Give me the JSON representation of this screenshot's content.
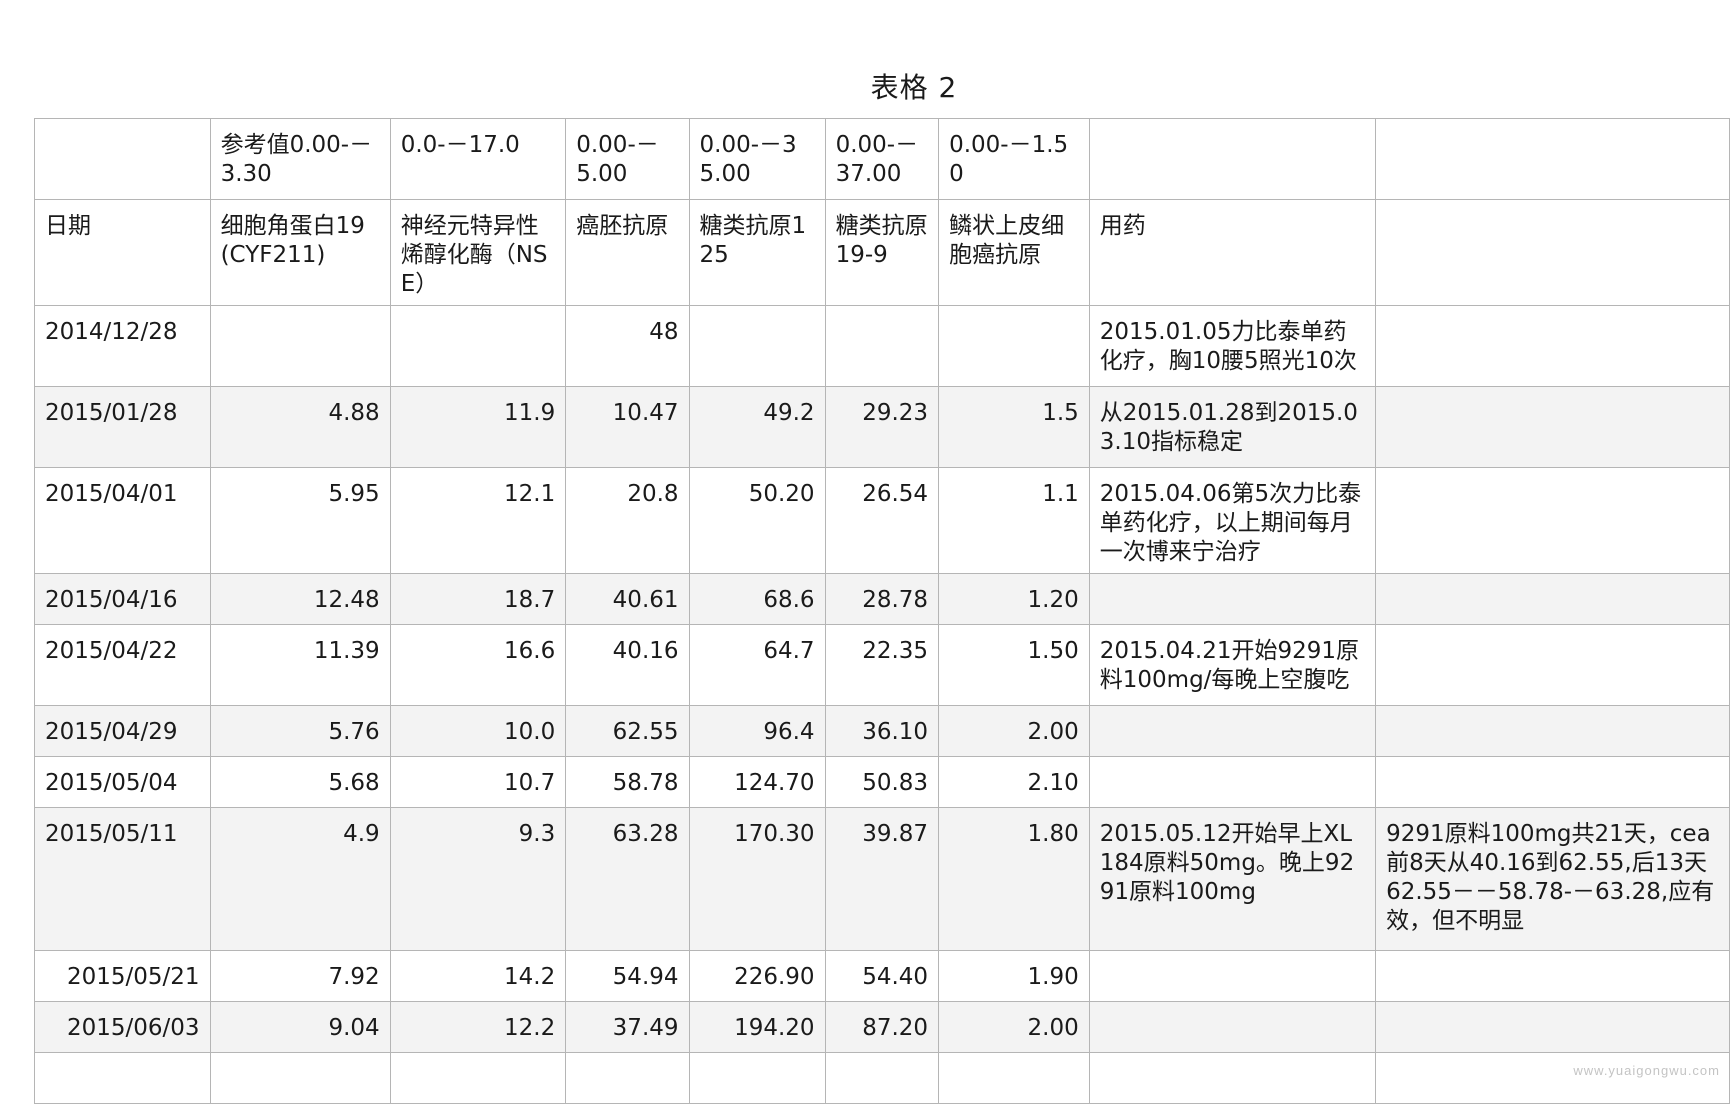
{
  "title": "表格 2",
  "reference_row": [
    "",
    "参考值0.00-－3.30",
    "0.0-－17.0",
    "0.00-－5.00",
    "0.00-－35.00",
    "0.00-－37.00",
    "0.00-－1.50",
    "",
    ""
  ],
  "header_row": [
    "日期",
    "细胞角蛋白19(CYF211)",
    "神经元特异性烯醇化酶（NSE）",
    "癌胚抗原",
    "糖类抗原125",
    "糖类抗原19-9",
    "鳞状上皮细胞癌抗原",
    "用药",
    ""
  ],
  "rows": [
    [
      "2014/12/28",
      "",
      "",
      "48",
      "",
      "",
      "",
      "2015.01.05力比泰单药化疗，胸10腰5照光10次",
      ""
    ],
    [
      "2015/01/28",
      "4.88",
      "11.9",
      "10.47",
      "49.2",
      "29.23",
      "1.5",
      "从2015.01.28到2015.03.10指标稳定",
      ""
    ],
    [
      "2015/04/01",
      "5.95",
      "12.1",
      "20.8",
      "50.20",
      "26.54",
      "1.1",
      "2015.04.06第5次力比泰单药化疗，以上期间每月一次博来宁治疗",
      ""
    ],
    [
      "2015/04/16",
      "12.48",
      "18.7",
      "40.61",
      "68.6",
      "28.78",
      "1.20",
      "",
      ""
    ],
    [
      "2015/04/22",
      "11.39",
      "16.6",
      "40.16",
      "64.7",
      "22.35",
      "1.50",
      "2015.04.21开始9291原料100mg/每晚上空腹吃",
      ""
    ],
    [
      "2015/04/29",
      "5.76",
      "10.0",
      "62.55",
      "96.4",
      "36.10",
      "2.00",
      "",
      ""
    ],
    [
      "2015/05/04",
      "5.68",
      "10.7",
      "58.78",
      "124.70",
      "50.83",
      "2.10",
      "",
      ""
    ],
    [
      "2015/05/11",
      "4.9",
      "9.3",
      "63.28",
      "170.30",
      "39.87",
      "1.80",
      "2015.05.12开始早上XL184原料50mg。晚上9291原料100mg",
      "9291原料100mg共21天，cea前8天从40.16到62.55,后13天62.55－－58.78-－63.28,应有效，但不明显"
    ],
    [
      "2015/05/21",
      "7.92",
      "14.2",
      "54.94",
      "226.90",
      "54.40",
      "1.90",
      "",
      ""
    ],
    [
      "2015/06/03",
      "9.04",
      "12.2",
      "37.49",
      "194.20",
      "87.20",
      "2.00",
      "",
      ""
    ],
    [
      "",
      "",
      "",
      "",
      "",
      "",
      "",
      "",
      ""
    ]
  ],
  "watermark": "www.yuaigongwu.com"
}
